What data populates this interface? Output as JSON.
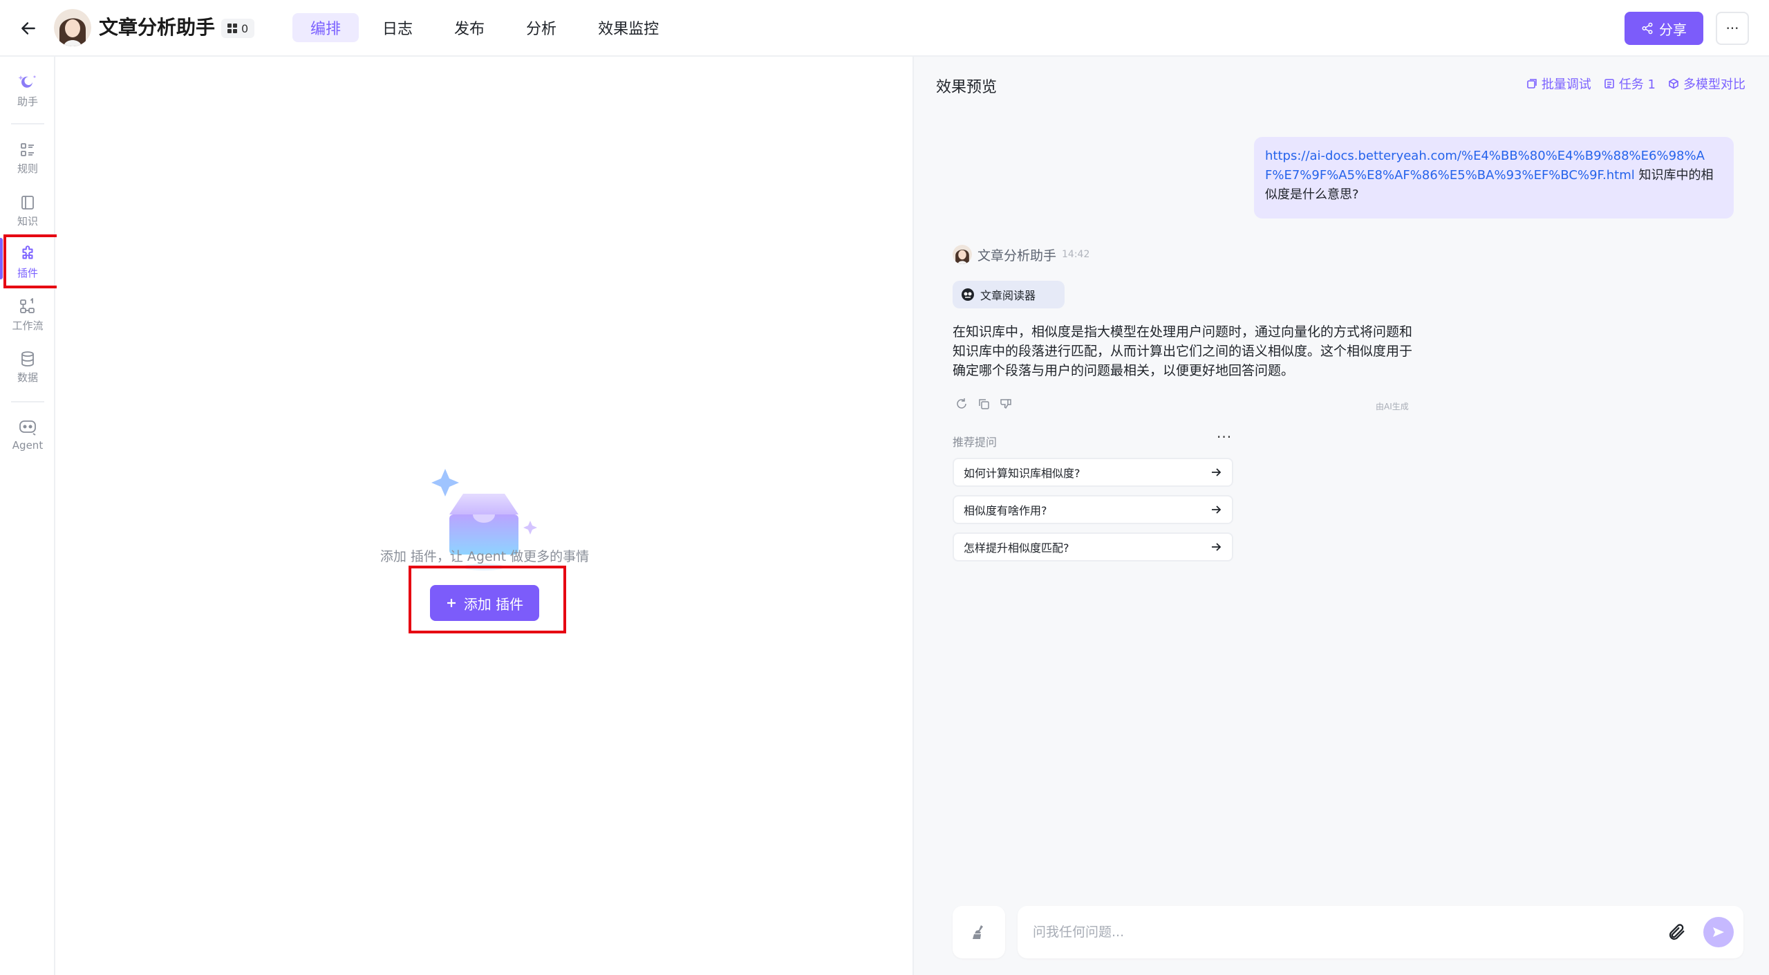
{
  "header": {
    "title": "文章分析助手",
    "badge_count": "0",
    "tabs": [
      {
        "label": "编排",
        "active": true
      },
      {
        "label": "日志",
        "active": false
      },
      {
        "label": "发布",
        "active": false
      },
      {
        "label": "分析",
        "active": false
      },
      {
        "label": "效果监控",
        "active": false
      }
    ],
    "share_label": "分享",
    "more_label": "···"
  },
  "sidebar": {
    "items": [
      {
        "label": "助手",
        "icon": "assistant-icon"
      },
      {
        "label": "规则",
        "icon": "rules-icon"
      },
      {
        "label": "知识",
        "icon": "knowledge-icon"
      },
      {
        "label": "插件",
        "icon": "plugin-icon",
        "active": true
      },
      {
        "label": "工作流",
        "icon": "workflow-icon"
      },
      {
        "label": "数据",
        "icon": "database-icon"
      },
      {
        "label": "Agent",
        "icon": "agent-icon"
      }
    ]
  },
  "editor": {
    "empty_text": "添加 插件，让 Agent 做更多的事情",
    "add_button_label": "添加 插件"
  },
  "preview": {
    "title": "效果预览",
    "actions": [
      "批量调试",
      "任务 1",
      "多模型对比"
    ],
    "user_message": {
      "link": "https://ai-docs.betteryeah.com/%E4%BB%80%E4%B9%88%E6%98%AF%E7%9F%A5%E8%AF%86%E5%BA%93%EF%BC%9F.html",
      "text": " 知识库中的相似度是什么意思?"
    },
    "bot": {
      "name": "文章分析助手",
      "time": "14:42",
      "tool_label": "文章阅读器",
      "answer": "在知识库中，相似度是指大模型在处理用户问题时，通过向量化的方式将问题和知识库中的段落进行匹配，从而计算出它们之间的语义相似度。这个相似度用于确定哪个段落与用户的问题最相关，以便更好地回答问题。",
      "ai_note": "由AI生成"
    },
    "suggest_title": "推荐提问",
    "suggest_more": "···",
    "suggestions": [
      "如何计算知识库相似度?",
      "相似度有啥作用?",
      "怎样提升相似度匹配?"
    ],
    "input_placeholder": "问我任何问题...",
    "input_value": ""
  },
  "colors": {
    "accent": "#7c5cfa",
    "accent_light": "#eeebff",
    "annotation_red": "#e60012",
    "link": "#2563eb"
  }
}
